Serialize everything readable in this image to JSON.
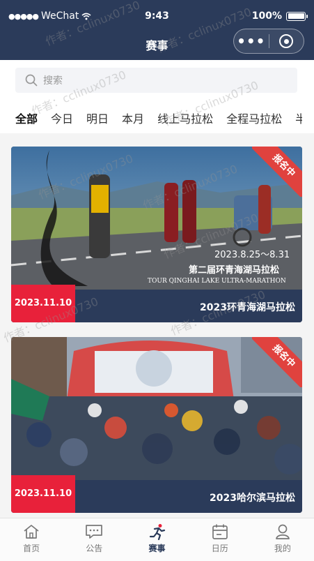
{
  "status_bar": {
    "carrier": "WeChat",
    "time": "9:43",
    "battery": "100%"
  },
  "navbar": {
    "title": "赛事",
    "more": "•••"
  },
  "search": {
    "placeholder": "搜索"
  },
  "tabs": [
    {
      "label": "全部",
      "active": true
    },
    {
      "label": "今日"
    },
    {
      "label": "明日"
    },
    {
      "label": "本月"
    },
    {
      "label": "线上马拉松"
    },
    {
      "label": "全程马拉松"
    },
    {
      "label": "半"
    }
  ],
  "events": [
    {
      "name": "2023环青海湖马拉松",
      "date": "2023.11.10",
      "status": "报名中",
      "poster_date": "2023.8.25～8.31",
      "poster_title": "第二届环青海湖马拉松",
      "poster_subtitle": "TOUR QINGHAI LAKE ULTRA-MARATHON"
    },
    {
      "name": "2023哈尔滨马拉松",
      "date": "2023.11.10",
      "status": "报名中"
    }
  ],
  "tabbar": [
    {
      "label": "首页",
      "icon": "home-icon"
    },
    {
      "label": "公告",
      "icon": "message-icon"
    },
    {
      "label": "赛事",
      "icon": "runner-icon",
      "active": true
    },
    {
      "label": "日历",
      "icon": "calendar-icon"
    },
    {
      "label": "我的",
      "icon": "user-icon"
    }
  ],
  "watermark": "作者：cclinux0730",
  "colors": {
    "navy": "#2b3b5a",
    "accent": "#e8213a",
    "ribbon": "#e0423e"
  }
}
